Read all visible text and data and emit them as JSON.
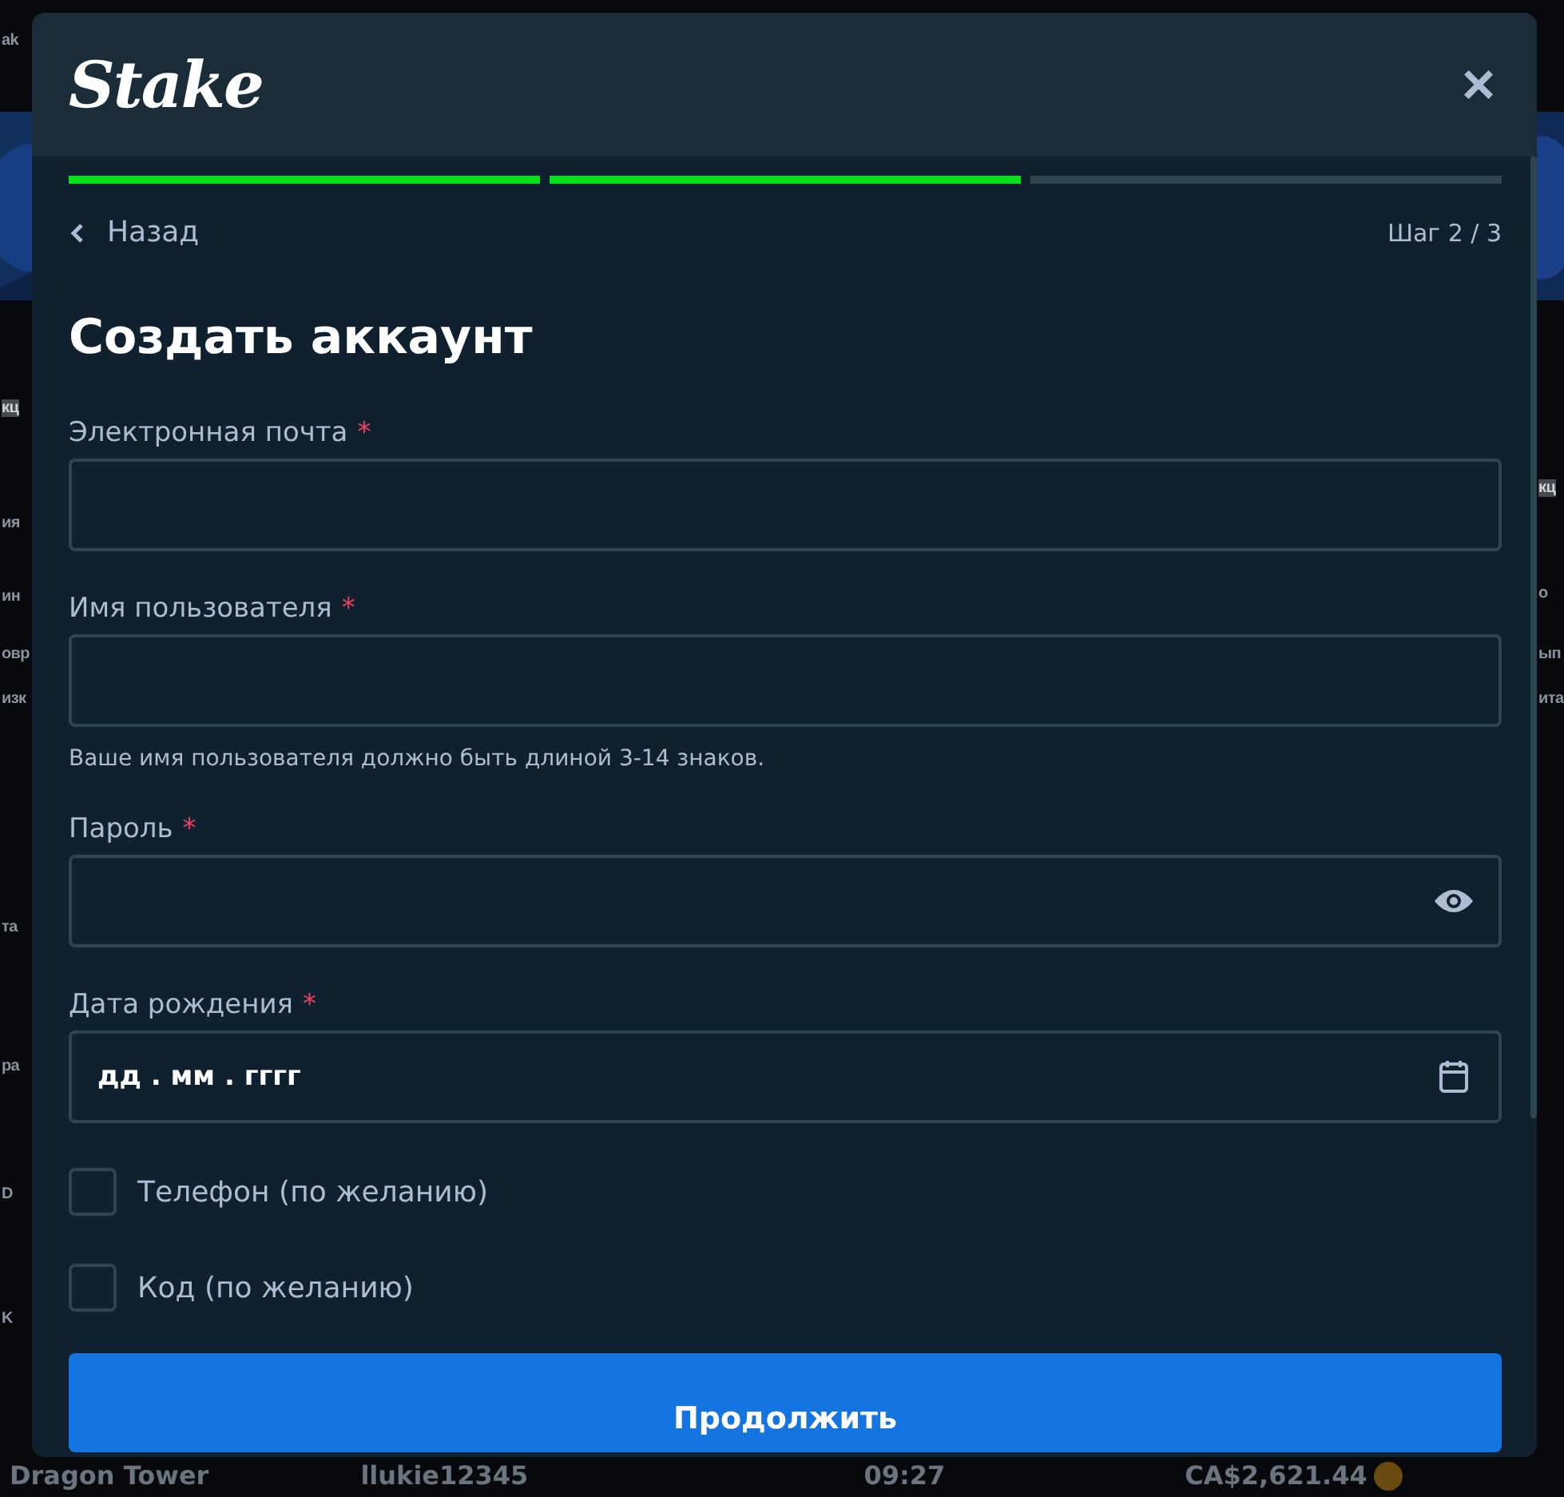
{
  "background": {
    "fragments_left": [
      "ak",
      "кц",
      "ия",
      "ин",
      "овр",
      "изк",
      "та",
      "ра",
      "D",
      "K"
    ],
    "fragments_right": [
      "кц",
      "о",
      "ып",
      "ита"
    ],
    "bottom_row": [
      "Dragon Tower",
      "llukie12345",
      "09:27",
      "CA$2,621.44"
    ]
  },
  "modal": {
    "logo": "Stake",
    "close": "×",
    "progress": [
      {
        "done": true
      },
      {
        "done": true
      },
      {
        "done": false
      }
    ],
    "back": "Назад",
    "step": "Шаг 2 / 3",
    "title": "Создать аккаунт",
    "fields": [
      {
        "kind": "text",
        "label": "Электронная почта",
        "required": "*"
      },
      {
        "kind": "text",
        "label": "Имя пользователя",
        "required": "*",
        "hint": "Ваше имя пользователя должно быть длиной 3-14 знаков."
      },
      {
        "kind": "password",
        "label": "Пароль",
        "required": "*"
      },
      {
        "kind": "date",
        "label": "Дата рождения",
        "required": "*",
        "placeholder": "дд . мм . гггг"
      }
    ],
    "options": [
      {
        "label": "Телефон (по желанию)",
        "checked": false
      },
      {
        "label": "Код (по желанию)",
        "checked": false
      }
    ],
    "submit": "Продолжить"
  }
}
